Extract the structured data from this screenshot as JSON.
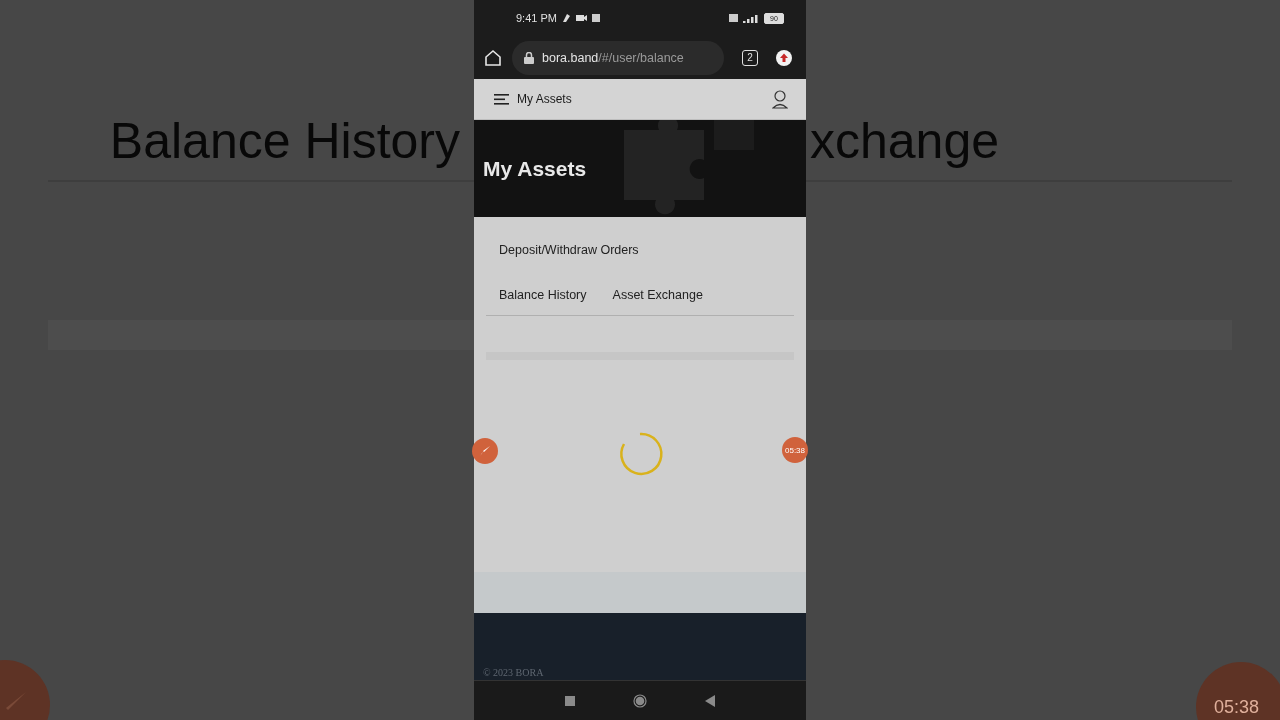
{
  "backdrop": {
    "heading_left": "Balance History",
    "heading_right": "xchange",
    "timer": "05:38"
  },
  "status_bar": {
    "time": "9:41 PM",
    "battery": "90"
  },
  "browser": {
    "url_host": "bora.band",
    "url_path": "/#/user/balance",
    "tab_count": "2"
  },
  "app_bar": {
    "title": "My Assets"
  },
  "hero": {
    "title": "My Assets"
  },
  "tabs": [
    {
      "label": "Deposit/Withdraw Orders",
      "kind": "wide"
    },
    {
      "label": "Balance History",
      "kind": "normal"
    },
    {
      "label": "Asset Exchange",
      "kind": "normal"
    }
  ],
  "recording": {
    "timer": "05:38"
  },
  "footer": {
    "copyright": "© 2023 BORA"
  }
}
